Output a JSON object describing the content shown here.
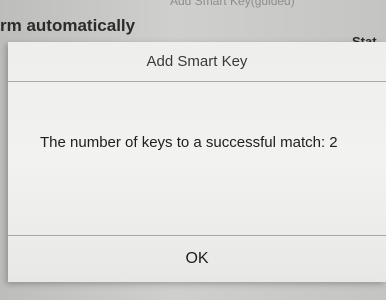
{
  "background": {
    "subtitle": "Add Smart Key(guided)",
    "heading": "rm automatically",
    "status_label": "Stat"
  },
  "dialog": {
    "title": "Add Smart Key",
    "message": "The number of keys to a successful match: 2",
    "ok_label": "OK"
  }
}
